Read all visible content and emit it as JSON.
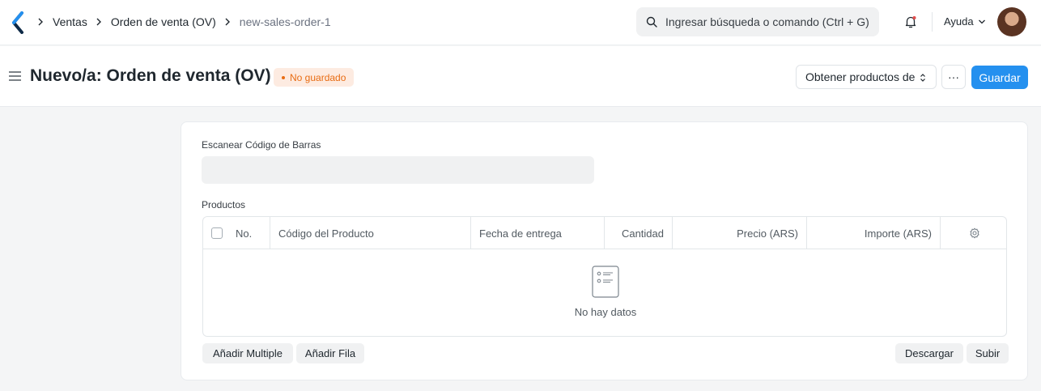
{
  "navbar": {
    "breadcrumbs": [
      "Ventas",
      "Orden de venta (OV)",
      "new-sales-order-1"
    ],
    "search_placeholder": "Ingresar búsqueda o comando (Ctrl + G)",
    "help_label": "Ayuda"
  },
  "header": {
    "title": "Nuevo/a: Orden de venta (OV)",
    "status": "No guardado",
    "get_items_label": "Obtener productos de",
    "more_label": "···",
    "save_label": "Guardar"
  },
  "form": {
    "barcode_label": "Escanear Código de Barras",
    "items_label": "Productos",
    "columns": [
      "No.",
      "Código del Producto",
      "Fecha de entrega",
      "Cantidad",
      "Precio (ARS)",
      "Importe (ARS)"
    ],
    "empty_text": "No hay datos",
    "add_multiple_label": "Añadir Multiple",
    "add_row_label": "Añadir Fila",
    "download_label": "Descargar",
    "upload_label": "Subir"
  },
  "colors": {
    "primary": "#2490ef",
    "status_bg": "#fdebe1",
    "status_text": "#e86c13"
  }
}
